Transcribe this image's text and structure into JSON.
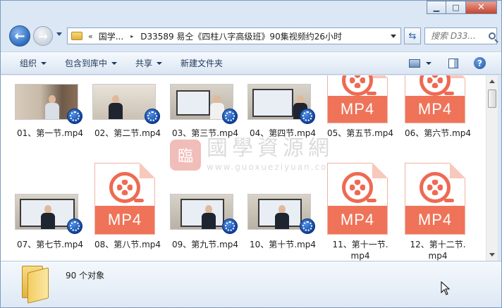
{
  "window": {
    "caption": {
      "minimize": "▁",
      "maximize": "□",
      "close": "✕"
    }
  },
  "address": {
    "overflow": "«",
    "crumbs": [
      "国学...",
      "D33589 易仝《四柱八字高级班》90集视频约26小时"
    ],
    "separator": "▸"
  },
  "search": {
    "placeholder": "搜索 D33..."
  },
  "toolbar": {
    "organize": "组织",
    "include_in_library": "包含到库中",
    "share": "共享",
    "new_folder": "新建文件夹"
  },
  "files": [
    {
      "name": "01、第一节.mp4",
      "kind": "video"
    },
    {
      "name": "02、第二节.mp4",
      "kind": "video"
    },
    {
      "name": "03、第三节.mp4",
      "kind": "video"
    },
    {
      "name": "04、第四节.mp4",
      "kind": "video"
    },
    {
      "name": "05、第五节.mp4",
      "kind": "mp4-icon"
    },
    {
      "name": "06、第六节.mp4",
      "kind": "mp4-icon"
    },
    {
      "name": "07、第七节.mp4",
      "kind": "video"
    },
    {
      "name": "08、第八节.mp4",
      "kind": "mp4-icon"
    },
    {
      "name": "09、第九节.mp4",
      "kind": "video"
    },
    {
      "name": "10、第十节.mp4",
      "kind": "video"
    },
    {
      "name": "11、第十一节.mp4",
      "line1": "11、第十一节.",
      "line2": "mp4",
      "kind": "mp4-icon"
    },
    {
      "name": "12、第十二节.mp4",
      "line1": "12、第十二节.",
      "line2": "mp4",
      "kind": "mp4-icon"
    }
  ],
  "mp4_badge": "MP4",
  "watermark": {
    "seal": "臨",
    "name": "國學資源網",
    "url": "www.guoxueziyuan.com"
  },
  "status": {
    "object_count": "90 个对象"
  }
}
